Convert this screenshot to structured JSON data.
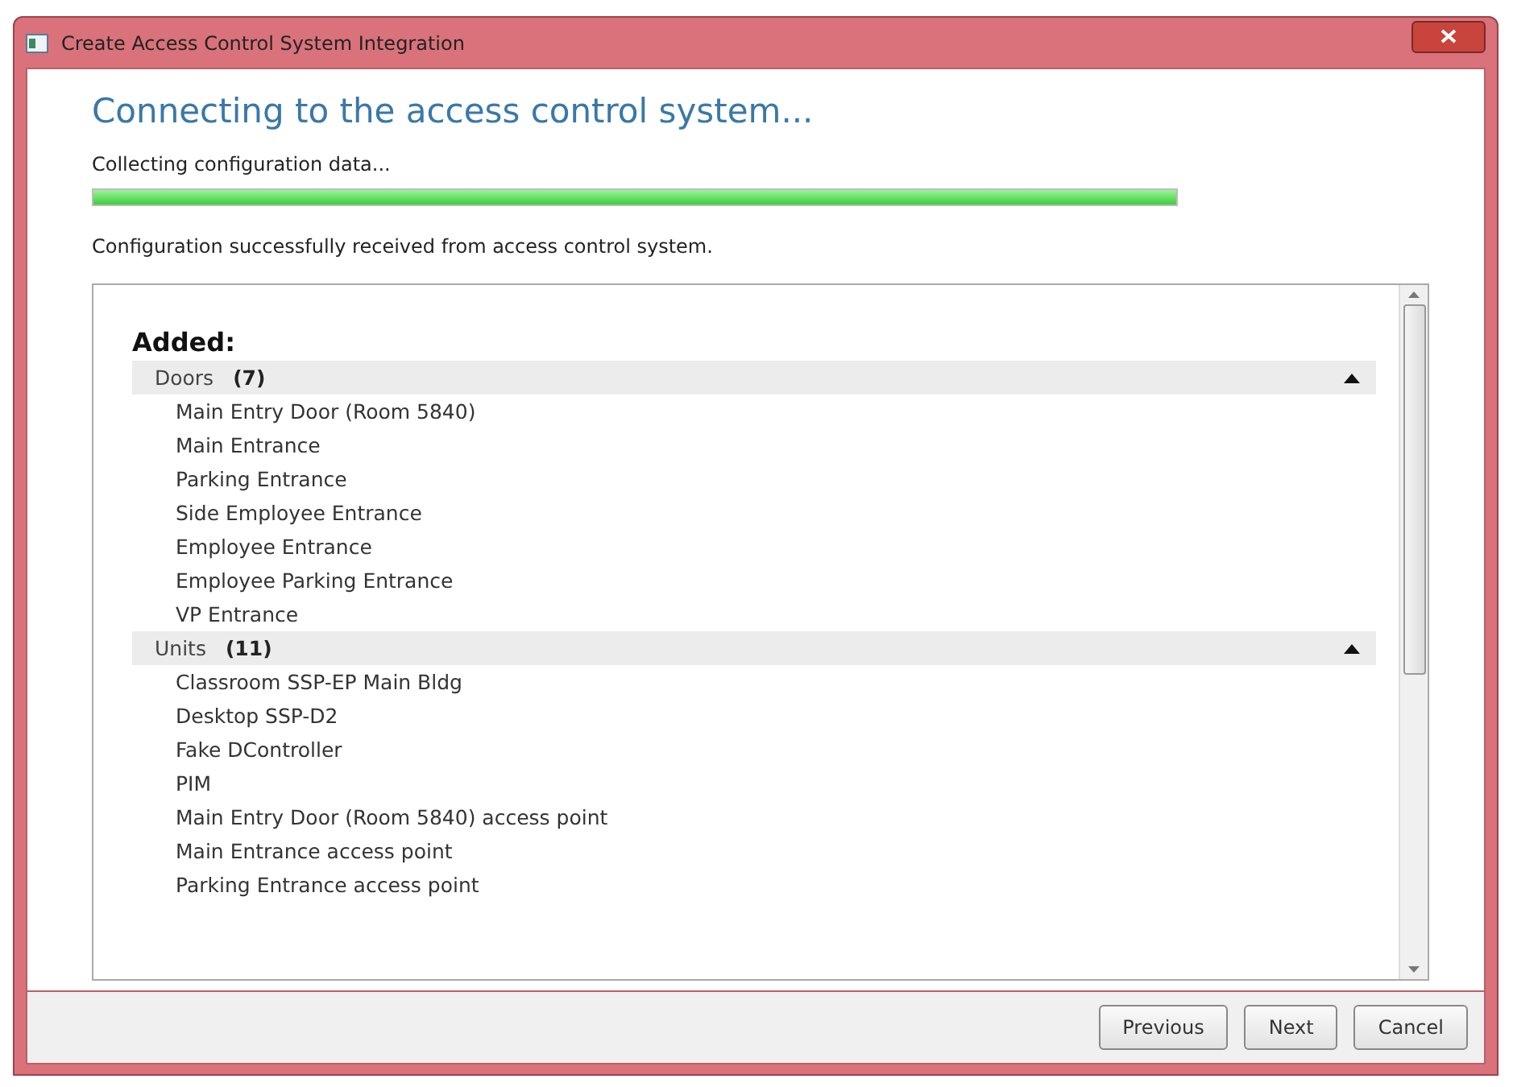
{
  "window": {
    "title": "Create Access Control System Integration"
  },
  "heading": "Connecting to the access control system...",
  "progress": {
    "label": "Collecting configuration data...",
    "level": 1
  },
  "status": "Configuration successfully received from access control system.",
  "results": {
    "title": "Added:",
    "groups": [
      {
        "name": "Doors",
        "count": "(7)",
        "expanded": true,
        "items": [
          "Main Entry Door (Room 5840)",
          "Main Entrance",
          "Parking Entrance",
          "Side Employee Entrance",
          "Employee Entrance",
          "Employee Parking Entrance",
          "VP Entrance"
        ]
      },
      {
        "name": "Units",
        "count": "(11)",
        "expanded": true,
        "items": [
          "Classroom SSP-EP Main Bldg",
          "Desktop SSP-D2",
          "Fake DController",
          "PIM",
          "Main Entry Door (Room 5840) access point",
          "Main Entrance access point",
          "Parking Entrance access point"
        ]
      }
    ]
  },
  "buttons": [
    "Previous",
    "Next",
    "Cancel"
  ]
}
